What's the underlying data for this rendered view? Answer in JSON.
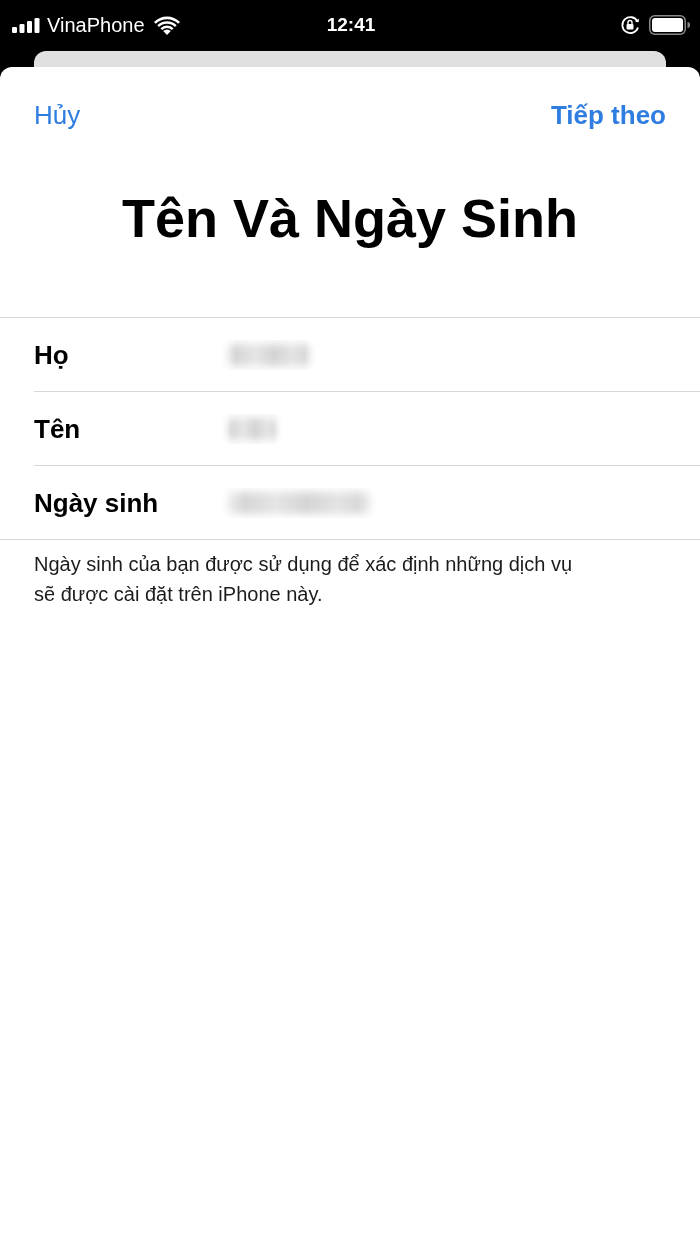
{
  "status_bar": {
    "carrier": "VinaPhone",
    "time": "12:41"
  },
  "nav": {
    "cancel": "Hủy",
    "next": "Tiếp theo"
  },
  "title": "Tên Và Ngày Sinh",
  "fields": [
    {
      "label": "Họ"
    },
    {
      "label": "Tên"
    },
    {
      "label": "Ngày sinh"
    }
  ],
  "footnote": "Ngày sinh của bạn được sử dụng để xác định những dịch vụ sẽ được cài đặt trên iPhone này."
}
